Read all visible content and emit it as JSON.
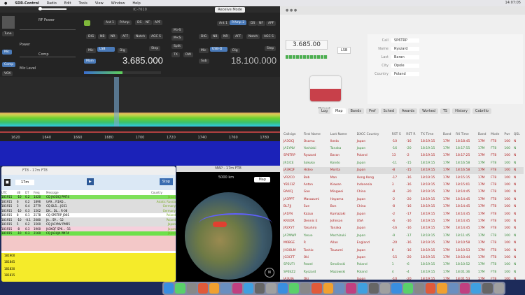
{
  "menubar": {
    "app": "SDR-Control",
    "items": [
      "Radio",
      "Edit",
      "Tools",
      "View",
      "Window",
      "Help"
    ],
    "clock": "14:07:05"
  },
  "sdr": {
    "title": "IC-7610",
    "rx_button": "Receive Mode",
    "left_buttons": [
      "Tune",
      "Mic",
      "Comp",
      "VOX"
    ],
    "labels": {
      "rf_power": "RF Power",
      "mic_level": "Mic Level",
      "power": "Power",
      "comp": "Comp"
    },
    "vfoA": {
      "buttons": [
        "Att",
        "Ant 1",
        "P.Amp",
        "DS",
        "NF",
        "APF"
      ],
      "row2": [
        "DIG",
        "NB",
        "NR",
        "AFF",
        "Notch",
        "AGC S"
      ],
      "modes": [
        "Mic",
        "LSB",
        "Dig",
        "Main",
        "Step"
      ],
      "freq": "3.685.000"
    },
    "center": [
      "M>S",
      "M<S",
      "Split",
      "TX",
      "DW"
    ],
    "vfoB": {
      "buttons": [
        "Ant 1",
        "P.Amp 2",
        "DS",
        "NF",
        "APF"
      ],
      "row2": [
        "DIG",
        "NB",
        "NR",
        "AFF",
        "Notch",
        "AGC S"
      ],
      "modes": [
        "Mic",
        "USB-D",
        "Dig",
        "Sub",
        "Step"
      ],
      "freq": "18.100.000"
    },
    "axis": [
      "1620",
      "1640",
      "1660",
      "1680",
      "1700",
      "1720",
      "1740",
      "1760",
      "1780"
    ]
  },
  "logger": {
    "freq": "3.685.00",
    "mode": "LSB",
    "country": "Poland",
    "form": [
      [
        "Call",
        "SP6TRP"
      ],
      [
        "Name",
        "Ryszard"
      ],
      [
        "Last",
        "Baran"
      ],
      [
        "City",
        "Opole"
      ],
      [
        "Country",
        "Poland"
      ]
    ],
    "tabs": [
      "Log",
      "Map",
      "Bands",
      "Pref",
      "Sched",
      "Awards",
      "Worked",
      "TS",
      "History",
      "Cabrillo"
    ],
    "columns": [
      "Callsign",
      "First Name",
      "Last Name",
      "DXCC Country",
      "RST S",
      "RST R",
      "TX Time",
      "Band",
      "RX Time",
      "Band",
      "Mode",
      "Pwr",
      "QSL"
    ],
    "rows": [
      [
        "JA3OCJ",
        "Osamu",
        "Ikeda",
        "Japan",
        "-10",
        "-16",
        "18:19:15",
        "17M",
        "18:18:45",
        "17M",
        "FT8",
        "100",
        "N"
      ],
      [
        "JA1YNV",
        "Yoshiaki",
        "Tanaka",
        "Japan",
        "-16",
        "-20",
        "18:19:15",
        "17M",
        "18:17:55",
        "17M",
        "FT8",
        "100",
        "N"
      ],
      [
        "SP6TRP",
        "Ryszard",
        "Baran",
        "Poland",
        "13",
        "-2",
        "18:19:15",
        "17M",
        "18:17:25",
        "17M",
        "FT8",
        "100",
        "N"
      ],
      [
        "JR1ICE",
        "Sakuko",
        "Kondo",
        "Japan",
        "-11",
        "-15",
        "18:19:15",
        "17M",
        "18:16:58",
        "17M",
        "FT8",
        "100",
        "N"
      ],
      [
        "JA3KQF",
        "Hideo",
        "Morita",
        "Japan",
        "-8",
        "-15",
        "18:19:15",
        "17M",
        "18:16:58",
        "17M",
        "FT8",
        "100",
        "N"
      ],
      [
        "VR2CO",
        "Bob",
        "Man",
        "Hong Kong",
        "-17",
        "-16",
        "18:19:15",
        "17M",
        "18:15:15",
        "17M",
        "FT8",
        "100",
        "N"
      ],
      [
        "YB1CIZ",
        "Anton",
        "Kiswan",
        "Indonesia",
        "3",
        "-16",
        "18:19:15",
        "17M",
        "18:15:01",
        "17M",
        "FT8",
        "100",
        "N"
      ],
      [
        "BA4CJ",
        "Gao",
        "Mingwei",
        "China",
        "-8",
        "-20",
        "18:19:15",
        "17M",
        "18:14:45",
        "17M",
        "FT8",
        "100",
        "N"
      ],
      [
        "JA3PPT",
        "Masazumi",
        "Hayama",
        "Japan",
        "-2",
        "-20",
        "18:19:15",
        "17M",
        "18:14:45",
        "17M",
        "FT8",
        "100",
        "N"
      ],
      [
        "BL7JJ",
        "Sue",
        "Bon",
        "China",
        "-8",
        "-16",
        "18:19:15",
        "17M",
        "18:14:45",
        "17M",
        "FT8",
        "100",
        "N"
      ],
      [
        "JA1FN",
        "Kazuo",
        "Kumazaki",
        "Japan",
        "-2",
        "-17",
        "18:19:15",
        "17M",
        "18:14:45",
        "17M",
        "FT8",
        "100",
        "N"
      ],
      [
        "KR4OR",
        "Dennis E",
        "Johnson",
        "USA",
        "-6",
        "-16",
        "18:19:15",
        "17M",
        "18:14:45",
        "17M",
        "FT8",
        "100",
        "N"
      ],
      [
        "JP2XYT",
        "Yasuhiro",
        "Tanaka",
        "Japan",
        "-16",
        "-16",
        "18:19:15",
        "17M",
        "18:14:45",
        "17M",
        "FT8",
        "100",
        "N"
      ],
      [
        "JA7MWP",
        "Yasuo",
        "Mochizuki",
        "Japan",
        "-9",
        "-17",
        "18:19:15",
        "17M",
        "18:11:45",
        "17M",
        "FT8",
        "100",
        "N"
      ],
      [
        "M0BGE",
        "R",
        "Allan",
        "England",
        "-20",
        "-16",
        "18:19:15",
        "17M",
        "18:10:58",
        "17M",
        "FT8",
        "100",
        "N"
      ],
      [
        "JH3OLM",
        "Toshio",
        "Tsuzumi",
        "Japan",
        "6",
        "-16",
        "18:19:15",
        "17M",
        "18:10:53",
        "17M",
        "FT8",
        "100",
        "N"
      ],
      [
        "JG3CFT",
        "Oki",
        "",
        "Japan",
        "-15",
        "-20",
        "18:19:15",
        "17M",
        "18:10:44",
        "17M",
        "FT8",
        "100",
        "N"
      ],
      [
        "SP5UTI",
        "Pawel",
        "Smolinski",
        "Poland",
        "1",
        "-6",
        "18:19:15",
        "17M",
        "18:10:52",
        "17M",
        "FT8",
        "100",
        "N"
      ],
      [
        "SP6SZ2",
        "Ryszard",
        "Mazowski",
        "Poland",
        "4",
        "-4",
        "18:19:15",
        "17M",
        "18:01:36",
        "17M",
        "FT8",
        "100",
        "N"
      ],
      [
        "JA3UJA",
        "Oki",
        "",
        "Japan",
        "-10",
        "-20",
        "18:19:15",
        "17M",
        "18:01:53",
        "17M",
        "FT8",
        "100",
        "N"
      ]
    ],
    "green_rows": [
      1,
      3,
      13,
      17,
      18
    ],
    "selected_row": 4
  },
  "jtdx": {
    "title": "FT8 - 17m FT8",
    "band": "17m",
    "button": "Stop",
    "columns": [
      "UTC",
      "dB",
      "DT",
      "Freq",
      "Message",
      "Country"
    ],
    "rows": [
      [
        "181915",
        "-10",
        "0.2",
        "1420",
        "CQ JA3OCJ PM74",
        "Japan"
      ],
      [
        "181915",
        "6",
        "0.2",
        "1896",
        "UA9... R1AD...",
        "Asiatic Russia"
      ],
      [
        "181915",
        "3",
        "0.4",
        "2779",
        "CQ DL5... JO31",
        "Germany"
      ],
      [
        "181915",
        "-10",
        "0.3",
        "1502",
        "DK... DL... R-08",
        "Germany"
      ],
      [
        "181915",
        "8",
        "0.1",
        "2178",
        "CQ SP6TRP JO81",
        "Poland"
      ],
      [
        "181915",
        "-10",
        "-0.1",
        "2080",
        "JA... SP... -12",
        "Poland"
      ],
      [
        "181915",
        "5",
        "0.2",
        "1500",
        "CQ JA1YNV PM95",
        "Japan"
      ],
      [
        "181915",
        "-8",
        "0.3",
        "1900",
        "JA3KQF SP6... -15",
        "Japan"
      ],
      [
        "181915",
        "-10",
        "0.3",
        "2160",
        "CQ JA3UJA PM74",
        "Japan"
      ]
    ],
    "lower": [
      "181900",
      "181845",
      "181830",
      "181815"
    ]
  },
  "map": {
    "title": "MAP - 17m FT8",
    "scale": "5000 km",
    "button": "Map"
  }
}
